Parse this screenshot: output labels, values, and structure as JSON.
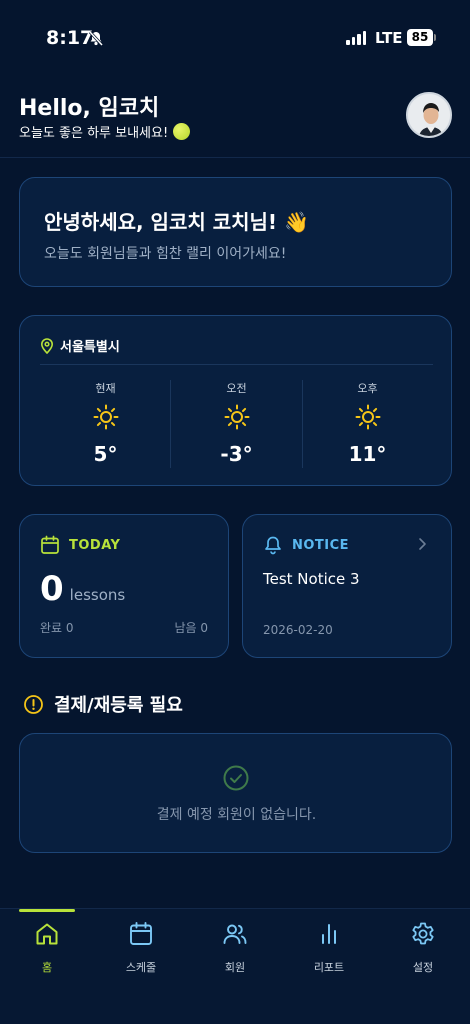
{
  "status_bar": {
    "time": "8:17",
    "network": "LTE",
    "battery": "85"
  },
  "header": {
    "title": "Hello, 임코치",
    "subtitle": "오늘도 좋은 하루 보내세요!"
  },
  "welcome": {
    "title": "안녕하세요, 임코치 코치님! 👋",
    "subtitle": "오늘도 회원님들과 힘찬 랠리 이어가세요!"
  },
  "weather": {
    "location": "서울특별시",
    "slots": [
      {
        "label": "현재",
        "temp": "5°",
        "icon": "sun-icon"
      },
      {
        "label": "오전",
        "temp": "-3°",
        "icon": "sun-icon"
      },
      {
        "label": "오후",
        "temp": "11°",
        "icon": "sun-icon"
      }
    ]
  },
  "today": {
    "heading": "TODAY",
    "count": "0",
    "unit": "lessons",
    "done": "완료 0",
    "remaining": "남음 0"
  },
  "notice": {
    "heading": "NOTICE",
    "title": "Test Notice 3",
    "date": "2026-02-20"
  },
  "payment": {
    "heading": "결제/재등록 필요",
    "empty": "결제 예정 회원이 없습니다."
  },
  "nav": {
    "items": [
      {
        "label": "홈",
        "icon": "home-icon",
        "active": true
      },
      {
        "label": "스케줄",
        "icon": "calendar-icon"
      },
      {
        "label": "회원",
        "icon": "users-icon"
      },
      {
        "label": "리포트",
        "icon": "bar-chart-icon"
      },
      {
        "label": "설정",
        "icon": "gear-icon"
      }
    ]
  },
  "colors": {
    "background": "#05152e",
    "card": "#081f3f",
    "accent_green": "#b8e23a",
    "accent_blue": "#5ab8f0",
    "sun": "#f5c518"
  }
}
